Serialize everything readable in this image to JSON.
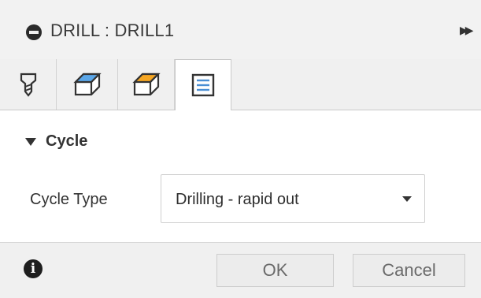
{
  "dialog": {
    "title": "DRILL : DRILL1",
    "tabs": [
      {
        "icon": "drill-tool-icon"
      },
      {
        "icon": "geometry-box-icon"
      },
      {
        "icon": "heights-box-icon"
      },
      {
        "icon": "passes-list-icon",
        "active": true
      }
    ],
    "section": {
      "title": "Cycle"
    },
    "cycle_type": {
      "label": "Cycle Type",
      "value": "Drilling - rapid out"
    },
    "footer": {
      "ok_label": "OK",
      "cancel_label": "Cancel"
    }
  }
}
